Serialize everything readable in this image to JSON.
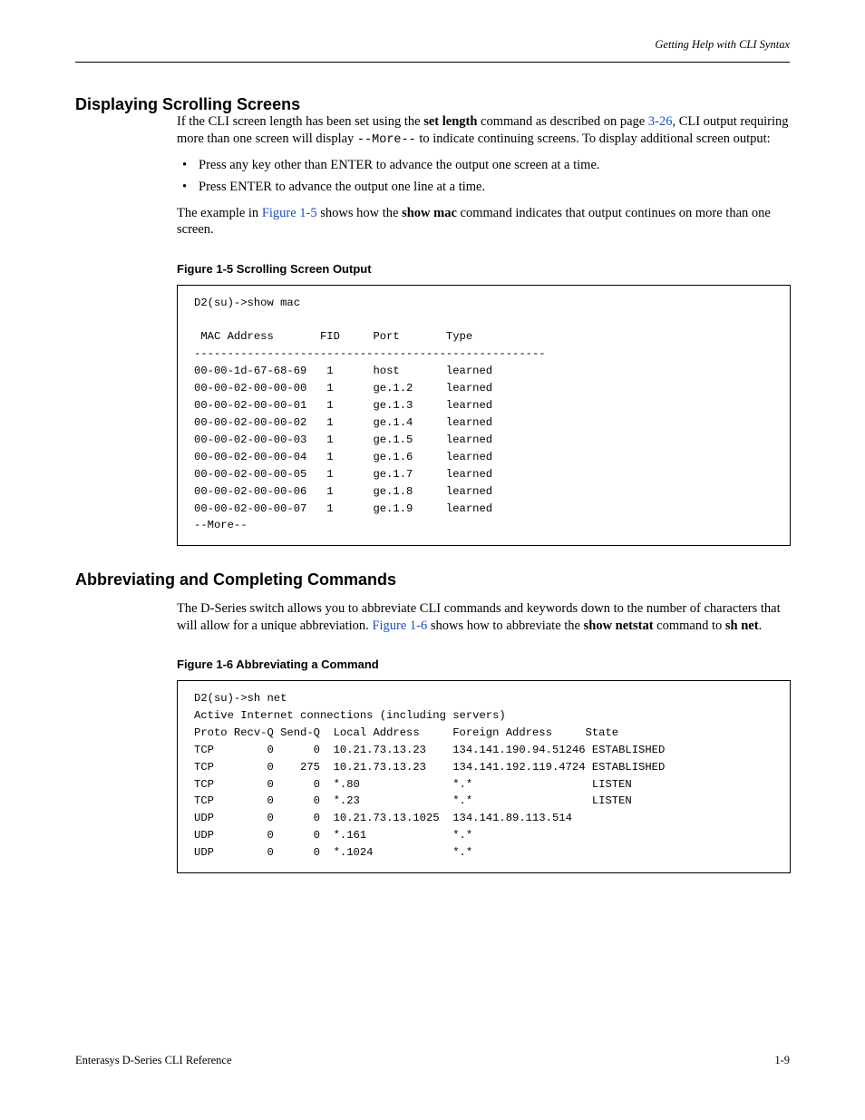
{
  "header": {
    "text": "Getting Help with CLI Syntax"
  },
  "section1": {
    "heading": "Displaying Scrolling Screens",
    "p1_a": "If the CLI screen length has been set using the ",
    "p1_b": "set length",
    "p1_c": " command as described on page ",
    "p1_link": "3-26",
    "p1_d": ", CLI output requiring more than one screen will display ",
    "p1_mono": "--More--",
    "p1_e": " to indicate continuing screens. To display additional screen output:",
    "bullet1": "Press any key other than ENTER to advance the output one screen at a time.",
    "bullet2": "Press ENTER to advance the output one line at a time.",
    "p2_a": "The example in ",
    "p2_link": "Figure 1-5",
    "p2_b": " shows how the ",
    "p2_bold": "show mac",
    "p2_c": " command indicates that output continues on more than one screen.",
    "fig_caption": "Figure 1-5    Scrolling Screen Output",
    "code": "D2(su)->show mac\n\n MAC Address       FID     Port       Type\n-----------------------------------------------------\n00-00-1d-67-68-69   1      host       learned\n00-00-02-00-00-00   1      ge.1.2     learned\n00-00-02-00-00-01   1      ge.1.3     learned\n00-00-02-00-00-02   1      ge.1.4     learned\n00-00-02-00-00-03   1      ge.1.5     learned\n00-00-02-00-00-04   1      ge.1.6     learned\n00-00-02-00-00-05   1      ge.1.7     learned\n00-00-02-00-00-06   1      ge.1.8     learned\n00-00-02-00-00-07   1      ge.1.9     learned\n--More--"
  },
  "section2": {
    "heading": "Abbreviating and Completing Commands",
    "p1_a": "The D-Series switch allows you to abbreviate CLI commands and keywords down to the number of characters that will allow for a unique abbreviation. ",
    "p1_link": "Figure 1-6",
    "p1_b": " shows how to abbreviate the ",
    "p1_bold1": "show netstat",
    "p1_c": " command to ",
    "p1_bold2": "sh net",
    "p1_d": ".",
    "fig_caption": "Figure 1-6    Abbreviating a Command",
    "code": "D2(su)->sh net\nActive Internet connections (including servers)\nProto Recv-Q Send-Q  Local Address     Foreign Address     State\nTCP        0      0  10.21.73.13.23    134.141.190.94.51246 ESTABLISHED\nTCP        0    275  10.21.73.13.23    134.141.192.119.4724 ESTABLISHED\nTCP        0      0  *.80              *.*                  LISTEN\nTCP        0      0  *.23              *.*                  LISTEN\nUDP        0      0  10.21.73.13.1025  134.141.89.113.514\nUDP        0      0  *.161             *.*\nUDP        0      0  *.1024            *.*"
  },
  "footer": {
    "left": "Enterasys D-Series CLI Reference",
    "right": "1-9"
  }
}
